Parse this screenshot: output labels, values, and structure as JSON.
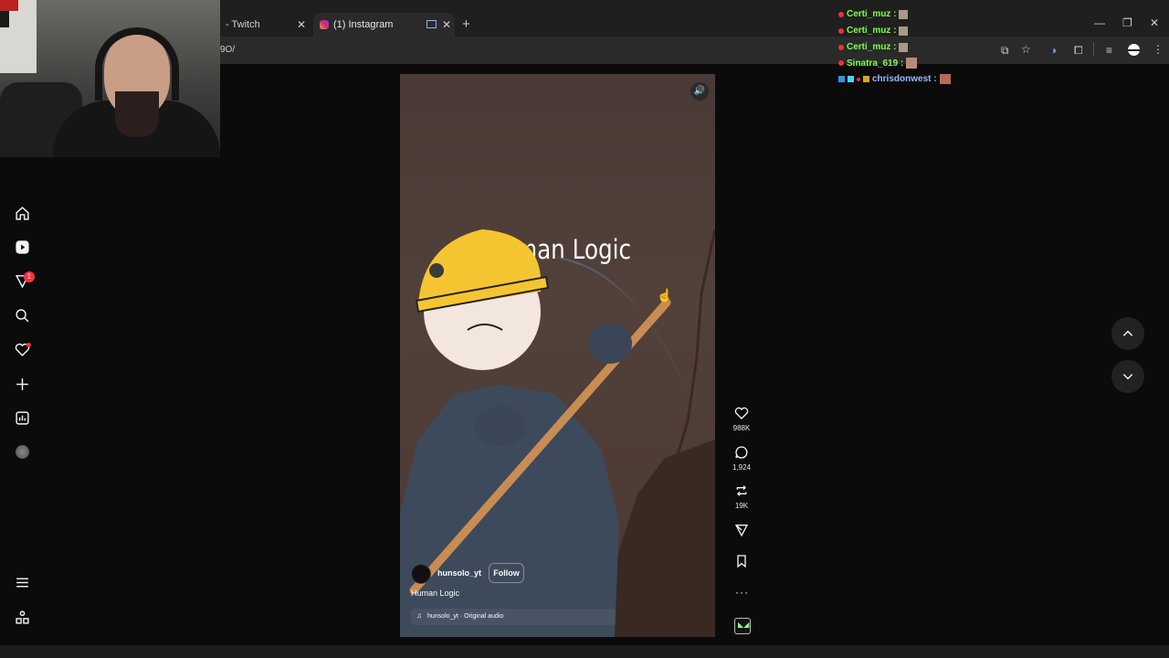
{
  "browser": {
    "tabs": [
      {
        "label": "- Twitch"
      },
      {
        "label": "(1) Instagram"
      }
    ],
    "url_fragment": "9O/",
    "new_tab": "+"
  },
  "nav": {
    "notifications_badge": "1"
  },
  "reel": {
    "title": "Human Logic",
    "username": "hunsolo_yt",
    "follow_label": "Follow",
    "caption": "Human Logic",
    "audio": "hunsolo_yt · Original audio"
  },
  "actions": {
    "likes": "988K",
    "comments": "1,924",
    "reposts": "19K"
  },
  "chat": [
    {
      "user": "Certi_muz :",
      "color": "#7cff4f"
    },
    {
      "user": "Certi_muz :",
      "color": "#7cff4f"
    },
    {
      "user": "Certi_muz :",
      "color": "#7cff4f"
    },
    {
      "user": "Sinatra_619 :",
      "color": "#7cff4f"
    },
    {
      "user": "chrisdonwest :",
      "color": "#9ab8ff"
    }
  ],
  "colors": {
    "accent_red": "#ff3040",
    "reel_bg": "#4a3a35"
  }
}
